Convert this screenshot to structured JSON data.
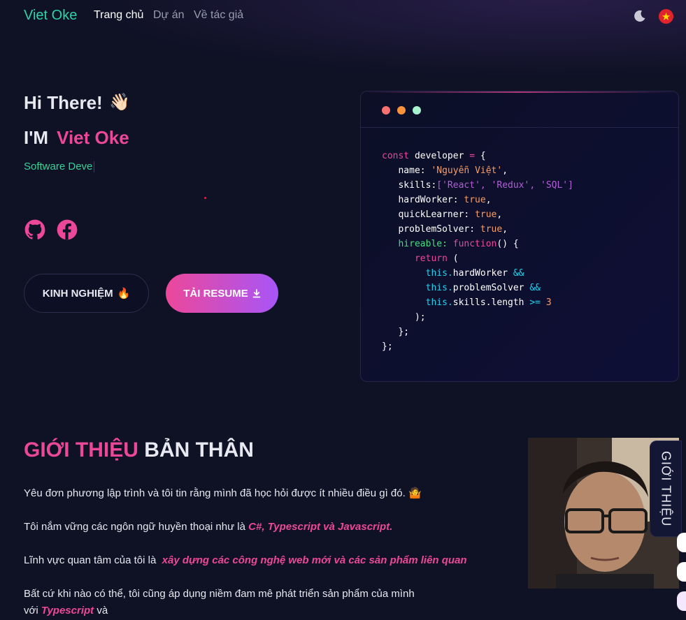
{
  "nav": {
    "brand": "Viet Oke",
    "links": [
      "Trang chủ",
      "Dự án",
      "Về tác giả"
    ]
  },
  "hero": {
    "greeting": "Hi There!",
    "wave": "👋🏻",
    "im_prefix": "I'M",
    "name": "Viet Oke",
    "role": "Software Deve",
    "btn_experience": "KINH NGHIỆM",
    "btn_experience_icon": "🔥",
    "btn_resume": "TẢI RESUME"
  },
  "code_lines": [
    [
      {
        "t": "const ",
        "c": "c-pink"
      },
      {
        "t": "developer ",
        "c": ""
      },
      {
        "t": "= ",
        "c": "c-pink"
      },
      {
        "t": "{",
        "c": ""
      }
    ],
    [
      {
        "t": "   name: ",
        "c": ""
      },
      {
        "t": "'Nguyễn Việt'",
        "c": "c-orange"
      },
      {
        "t": ",",
        "c": ""
      }
    ],
    [
      {
        "t": "   skills:",
        "c": ""
      },
      {
        "t": "['React', 'Redux', 'SQL']",
        "c": "c-purple"
      }
    ],
    [
      {
        "t": "   hardWorker: ",
        "c": ""
      },
      {
        "t": "true",
        "c": "c-orange"
      },
      {
        "t": ",",
        "c": ""
      }
    ],
    [
      {
        "t": "   quickLearner: ",
        "c": ""
      },
      {
        "t": "true",
        "c": "c-orange"
      },
      {
        "t": ",",
        "c": ""
      }
    ],
    [
      {
        "t": "   problemSolver: ",
        "c": ""
      },
      {
        "t": "true",
        "c": "c-orange"
      },
      {
        "t": ",",
        "c": ""
      }
    ],
    [
      {
        "t": "   hireable: ",
        "c": "c-green"
      },
      {
        "t": "function",
        "c": "c-pink"
      },
      {
        "t": "() {",
        "c": ""
      }
    ],
    [
      {
        "t": "      return ",
        "c": "c-pink"
      },
      {
        "t": "(",
        "c": ""
      }
    ],
    [
      {
        "t": "        this.",
        "c": "c-cyan"
      },
      {
        "t": "hardWorker ",
        "c": ""
      },
      {
        "t": "&&",
        "c": "c-cyan"
      }
    ],
    [
      {
        "t": "        this.",
        "c": "c-cyan"
      },
      {
        "t": "problemSolver ",
        "c": ""
      },
      {
        "t": "&&",
        "c": "c-cyan"
      }
    ],
    [
      {
        "t": "        this.",
        "c": "c-cyan"
      },
      {
        "t": "skills.length ",
        "c": ""
      },
      {
        "t": ">= ",
        "c": "c-cyan"
      },
      {
        "t": "3",
        "c": "c-orange"
      }
    ],
    [
      {
        "t": "      );",
        "c": ""
      }
    ],
    [
      {
        "t": "   };",
        "c": ""
      }
    ],
    [
      {
        "t": "};",
        "c": ""
      }
    ]
  ],
  "about": {
    "title_highlight": "GIỚI THIỆU",
    "title_rest": "BẢN THÂN",
    "p1": "Yêu đơn phương lập trình và tôi tin rằng mình đã học hỏi được ít nhiều điều gì đó.",
    "p1_emoji": "🤷",
    "p2_prefix": "Tôi nắm vững các ngôn ngữ huyền thoại như là",
    "p2_highlight": "C#, Typescript và Javascript.",
    "p3_prefix": "Lĩnh vực quan tâm của tôi là",
    "p3_highlight": "xây dựng các công nghệ web mới và các sản phẩm liên quan",
    "p4_line1": "Bất cứ khi nào có thể, tôi cũng áp dụng niềm đam mê phát triển sản phẩm của mình",
    "p4_prefix": "với",
    "p4_highlight": "Typescript",
    "p4_suffix": "và"
  },
  "side_tab": {
    "label": "GIỚI THIỆU"
  },
  "colors": {
    "accent_pink": "#ec4899",
    "accent_purple": "#a855f7",
    "accent_green": "#34d399",
    "background": "#0f1125"
  }
}
